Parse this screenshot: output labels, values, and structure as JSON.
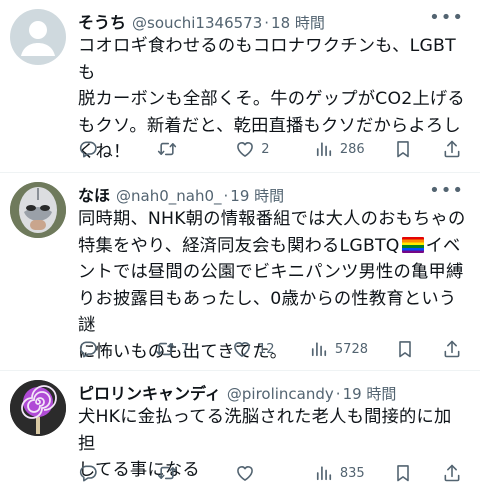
{
  "tweets": [
    {
      "name": "そうち",
      "handle": "@souchi1346573",
      "time": "18 時間",
      "lines": [
        "コオロギ食わせるのもコロナワクチンも、LGBTも",
        "脱カーボンも全部くそ。牛のゲップがCO2上げる",
        "もクソ。新着だと、乾田直播もクソだからよろし",
        "くね！"
      ],
      "actions": {
        "reply": "",
        "retweet": "",
        "like": "2",
        "views": "286"
      }
    },
    {
      "name": "なほ",
      "handle": "@nah0_nah0_",
      "time": "19 時間",
      "lines": [
        "同時期、NHK朝の情報番組では大人のおもちゃの",
        "特集をやり、経済同友会も関わるLGBTQ",
        "ントでは昼間の公園でビキニパンツ男性の亀甲縛",
        "りお披露目もあったし、0歳からの性教育という謎",
        "に怖いものも出てきてた。"
      ],
      "line2_suffix": "イベ",
      "actions": {
        "reply": "",
        "retweet": "7",
        "like": "12",
        "views": "5728"
      }
    },
    {
      "name": "ピロリンキャンディ",
      "handle": "@pirolincandy",
      "time": "19 時間",
      "lines": [
        "犬HKに金払ってる洗脳された老人も間接的に加担",
        "してる事になる"
      ],
      "actions": {
        "reply": "",
        "retweet": "",
        "like": "",
        "views": "835"
      }
    }
  ],
  "icons": [
    "more-icon",
    "reply-icon",
    "retweet-icon",
    "like-icon",
    "views-icon",
    "bookmark-icon",
    "share-icon",
    "rainbow-flag-emoji"
  ],
  "colors": {
    "text": "#0f1419",
    "secondary": "#536471",
    "divider": "#eff3f4",
    "lollipop": "#b04bd6"
  }
}
